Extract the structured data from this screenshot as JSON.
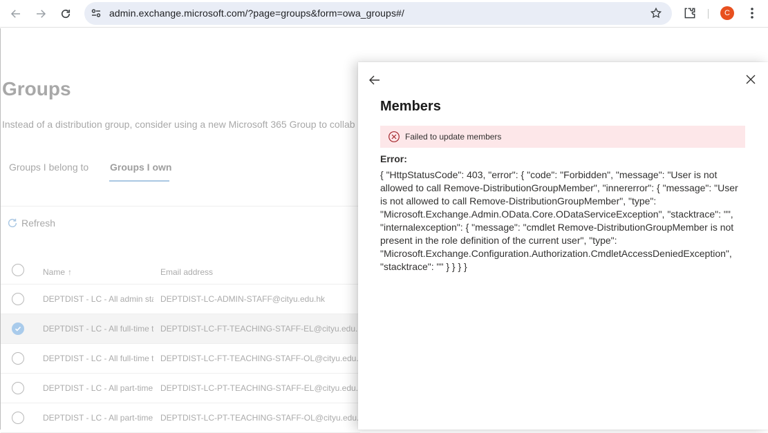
{
  "browser": {
    "url": "admin.exchange.microsoft.com/?page=groups&form=owa_groups#/",
    "profile_initial": "C",
    "profile_color": "#e8501f"
  },
  "page": {
    "title": "Groups",
    "description": "Instead of a distribution group, consider using a new Microsoft 365 Group to collab",
    "tabs": [
      {
        "label": "Groups I belong to"
      },
      {
        "label": "Groups I own"
      }
    ],
    "refresh_label": "Refresh",
    "table": {
      "columns": [
        "Name",
        "Email address"
      ],
      "sort_icon": "arrow-up",
      "rows": [
        {
          "name": "DEPTDIST - LC - All admin staff",
          "email": "DEPTDIST-LC-ADMIN-STAFF@cityu.edu.hk",
          "selected": false
        },
        {
          "name": "DEPTDIST - LC - All full-time teaching",
          "email": "DEPTDIST-LC-FT-TEACHING-STAFF-EL@cityu.edu.hk",
          "selected": true
        },
        {
          "name": "DEPTDIST - LC - All full-time teaching",
          "email": "DEPTDIST-LC-FT-TEACHING-STAFF-OL@cityu.edu.hk",
          "selected": false
        },
        {
          "name": "DEPTDIST - LC - All part-time teaching",
          "email": "DEPTDIST-LC-PT-TEACHING-STAFF-EL@cityu.edu.hk",
          "selected": false
        },
        {
          "name": "DEPTDIST - LC - All part-time teaching",
          "email": "DEPTDIST-LC-PT-TEACHING-STAFF-OL@cityu.edu.hk",
          "selected": false
        }
      ]
    }
  },
  "panel": {
    "title": "Members",
    "error_banner": "Failed to update members",
    "error_label": "Error:",
    "error_message": "{ \"HttpStatusCode\": 403, \"error\": { \"code\": \"Forbidden\", \"message\": \"User is not allowed to call Remove-DistributionGroupMember\", \"innererror\": { \"message\": \"User is not allowed to call Remove-DistributionGroupMember\", \"type\": \"Microsoft.Exchange.Admin.OData.Core.ODataServiceException\", \"stacktrace\": \"\", \"internalexception\": { \"message\": \"cmdlet Remove-DistributionGroupMember is not present in the role definition of the current user\", \"type\": \"Microsoft.Exchange.Configuration.Authorization.CmdletAccessDeniedException\", \"stacktrace\": \"\" } } } }",
    "error_color": "#fde7e9"
  }
}
